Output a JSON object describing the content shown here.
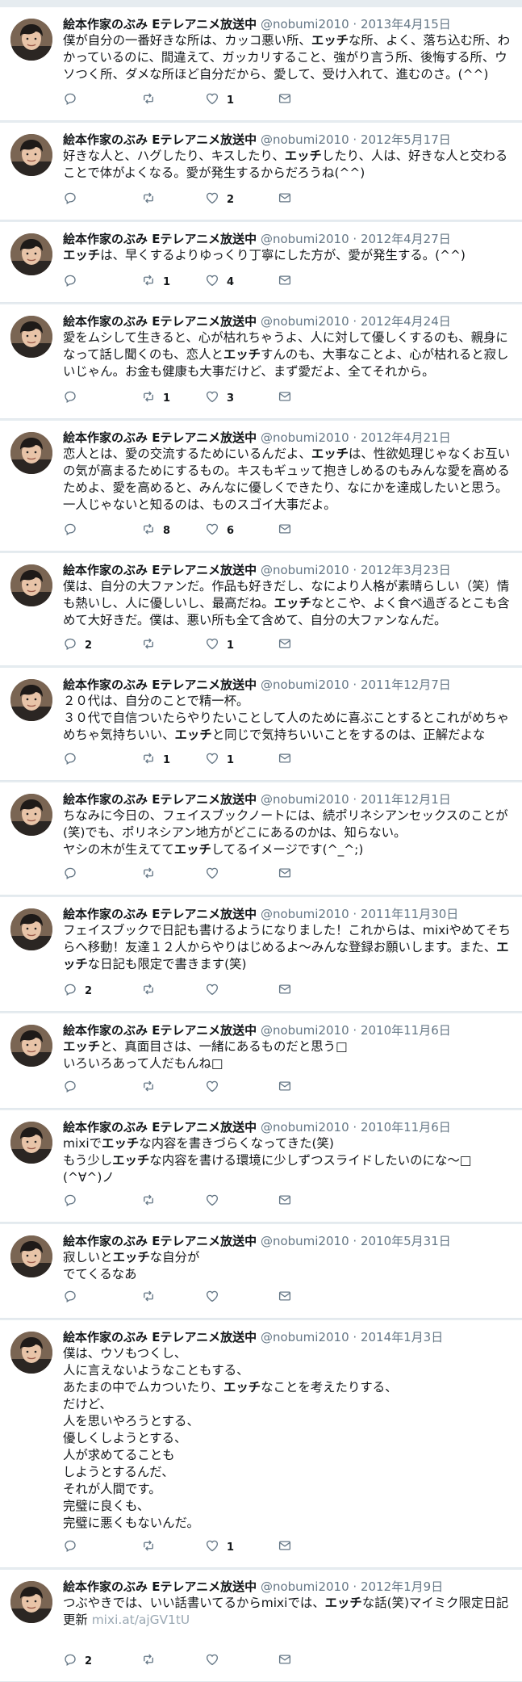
{
  "author": {
    "name": "絵本作家のぶみ Eテレアニメ放送中",
    "handle": "@nobumi2010"
  },
  "tweets": [
    {
      "date": "2013年4月15日",
      "lines": [
        "僕が自分の一番好きな所は、カッコ悪い所、<b>エッチ</b>な所、よく、落ち込む所、わかっているのに、間違えて、ガッカリすること、強がり言う所、後悔する所、ウソつく所、ダメな所ほど自分だから、愛して、受け入れて、進むのさ。(^^)"
      ],
      "replies": "",
      "retweets": "",
      "likes": "1"
    },
    {
      "date": "2012年5月17日",
      "lines": [
        "好きな人と、ハグしたり、キスしたり、<b>エッチ</b>したり、人は、好きな人と交わることで体がよくなる。愛が発生するからだろうね(^^)"
      ],
      "replies": "",
      "retweets": "",
      "likes": "2"
    },
    {
      "date": "2012年4月27日",
      "lines": [
        "<b>エッチ</b>は、早くするよりゆっくり丁寧にした方が、愛が発生する。(^^)"
      ],
      "replies": "",
      "retweets": "1",
      "likes": "4"
    },
    {
      "date": "2012年4月24日",
      "lines": [
        "愛をムシして生きると、心が枯れちゃうよ、人に対して優しくするのも、親身になって話し聞くのも、恋人と<b>エッチ</b>すんのも、大事なことよ、心が枯れると寂しいじゃん。お金も健康も大事だけど、まず愛だよ、全てそれから。"
      ],
      "replies": "",
      "retweets": "1",
      "likes": "3"
    },
    {
      "date": "2012年4月21日",
      "lines": [
        "恋人とは、愛の交流するためにいるんだよ、<b>エッチ</b>は、性欲処理じゃなくお互いの気が高まるためにするもの。キスもギュッて抱きしめるのもみんな愛を高めるためよ、愛を高めると、みんなに優しくできたり、なにかを達成したいと思う。一人じゃないと知るのは、ものスゴイ大事だよ。"
      ],
      "replies": "",
      "retweets": "8",
      "likes": "6"
    },
    {
      "date": "2012年3月23日",
      "lines": [
        "僕は、自分の大ファンだ。作品も好きだし、なにより人格が素晴らしい（笑）情も熱いし、人に優しいし、最高だね。<b>エッチ</b>なとこや、よく食べ過ぎるとこも含めて大好きだ。僕は、悪い所も全て含めて、自分の大ファンなんだ。"
      ],
      "replies": "2",
      "retweets": "",
      "likes": "1"
    },
    {
      "date": "2011年12月7日",
      "lines": [
        "２０代は、自分のことで精一杯。",
        "３０代で自信ついたらやりたいことして人のために喜ぶことするとこれがめちゃめちゃ気持ちいい、<b>エッチ</b>と同じで気持ちいいことをするのは、正解だよな"
      ],
      "replies": "",
      "retweets": "1",
      "likes": "1"
    },
    {
      "date": "2011年12月1日",
      "lines": [
        "ちなみに今日の、フェイスブックノートには、続ポリネシアンセックスのことが(笑)でも、ポリネシアン地方がどこにあるのかは、知らない。",
        "ヤシの木が生えてて<b>エッチ</b>してるイメージです(^_^;)"
      ],
      "replies": "",
      "retweets": "",
      "likes": ""
    },
    {
      "date": "2011年11月30日",
      "lines": [
        "フェイスブックで日記も書けるようになりました！これからは、mixiやめてそちらへ移動！友達１２人からやりはじめるよ〜みんな登録お願いします。また、<b>エッチ</b>な日記も限定で書きます(笑)"
      ],
      "replies": "2",
      "retweets": "",
      "likes": ""
    },
    {
      "date": "2010年11月6日",
      "lines": [
        "<b>エッチ</b>と、真面目さは、一緒にあるものだと思う□",
        "いろいろあって人だもんね□"
      ],
      "replies": "",
      "retweets": "",
      "likes": ""
    },
    {
      "date": "2010年11月6日",
      "lines": [
        "mixiで<b>エッチ</b>な内容を書きづらくなってきた(笑)",
        "もう少し<b>エッチ</b>な内容を書ける環境に少しずつスライドしたいのにな〜□",
        "(^∀^)ノ"
      ],
      "replies": "",
      "retweets": "",
      "likes": ""
    },
    {
      "date": "2010年5月31日",
      "lines": [
        "寂しいと<b>エッチ</b>な自分が",
        "でてくるなあ"
      ],
      "replies": "",
      "retweets": "",
      "likes": ""
    },
    {
      "date": "2014年1月3日",
      "lines": [
        "僕は、ウソもつくし、",
        "人に言えないようなこともする、",
        "あたまの中でムカついたり、<b>エッチ</b>なことを考えたりする、",
        "だけど、",
        "人を思いやろうとする、",
        "優しくしようとする、",
        "人が求めてることも",
        "しようとするんだ、",
        "それが人間です。",
        "完璧に良くも、",
        "完璧に悪くもないんだ。"
      ],
      "replies": "",
      "retweets": "",
      "likes": "1"
    },
    {
      "date": "2012年1月9日",
      "lines": [
        "つぶやきでは、いい話書いてるからmixiでは、<b>エッチ</b>な話(笑)マイミク限定日記更新 <span class=\"link\">mixi.at/ajGV1tU</span>"
      ],
      "replies": "2",
      "retweets": "",
      "likes": ""
    }
  ]
}
